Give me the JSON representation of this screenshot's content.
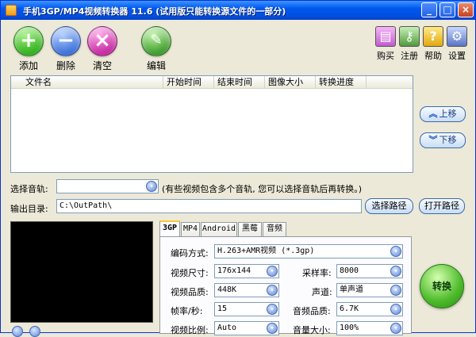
{
  "window": {
    "title": "手机3GP/MP4视频转换器 11.6 (试用版只能转换源文件的一部分)",
    "minimize": "_",
    "maximize": "□",
    "close": "×"
  },
  "toolbar": {
    "add_label": "添加",
    "delete_label": "删除",
    "clear_label": "清空",
    "edit_label": "编辑",
    "add_icon": "plus-icon",
    "delete_icon": "minus-icon",
    "clear_icon": "x-icon",
    "edit_icon": "edit-icon",
    "buy_label": "购买",
    "register_label": "注册",
    "help_label": "帮助",
    "settings_label": "设置"
  },
  "filelist": {
    "columns": [
      "文件名",
      "开始时间",
      "结束时间",
      "图像大小",
      "转换进度"
    ]
  },
  "side": {
    "up_label": "上移",
    "down_label": "下移"
  },
  "audio_track": {
    "label": "选择音轨:",
    "value": "",
    "hint": "(有些视频包含多个音轨, 您可以选择音轨后再转换。)"
  },
  "output": {
    "label": "输出目录:",
    "value": "C:\\OutPath\\",
    "choose_label": "选择路径",
    "open_label": "打开路径"
  },
  "tabs": [
    "3GP",
    "MP4",
    "Android",
    "黑莓",
    "音频"
  ],
  "settings": {
    "codec_label": "编码方式:",
    "codec_value": "H.263+AMR视频 (*.3gp)",
    "size_label": "视频尺寸:",
    "size_value": "176x144",
    "samplerate_label": "采样率:",
    "samplerate_value": "8000",
    "quality_label": "视频品质:",
    "quality_value": "448K",
    "channel_label": "声道:",
    "channel_value": "单声道",
    "fps_label": "帧率/秒:",
    "fps_value": "15",
    "audio_quality_label": "音频品质:",
    "audio_quality_value": "6.7K",
    "aspect_label": "视频比例:",
    "aspect_value": "Auto",
    "volume_label": "音量大小:",
    "volume_value": "100%"
  },
  "convert_label": "转换"
}
